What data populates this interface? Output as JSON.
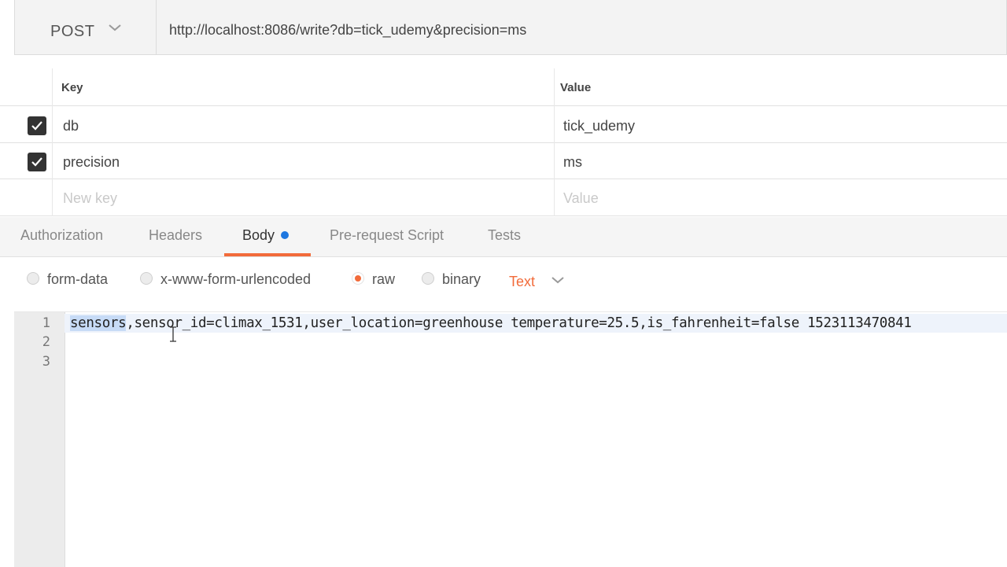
{
  "request": {
    "method": "POST",
    "url": "http://localhost:8086/write?db=tick_udemy&precision=ms"
  },
  "params": {
    "key_header": "Key",
    "value_header": "Value",
    "rows": [
      {
        "key": "db",
        "value": "tick_udemy",
        "checked": true
      },
      {
        "key": "precision",
        "value": "ms",
        "checked": true
      }
    ],
    "new_key_placeholder": "New key",
    "new_value_placeholder": "Value"
  },
  "tabs": [
    "Authorization",
    "Headers",
    "Body",
    "Pre-request Script",
    "Tests"
  ],
  "active_tab": "Body",
  "body_types": [
    "form-data",
    "x-www-form-urlencoded",
    "raw",
    "binary"
  ],
  "selected_body_type": "raw",
  "raw_format": "Text",
  "editor": {
    "line_numbers": [
      "1",
      "2",
      "3"
    ],
    "selected_text": "sensors",
    "rest_of_line1": ",sensor_id=climax_1531,user_location=greenhouse temperature=25.5,is_fahrenheit=false 1523113470841"
  },
  "colors": {
    "accent": "#f26b3a",
    "dirty_dot": "#1e77e0",
    "selection": "#c7dbf6"
  }
}
